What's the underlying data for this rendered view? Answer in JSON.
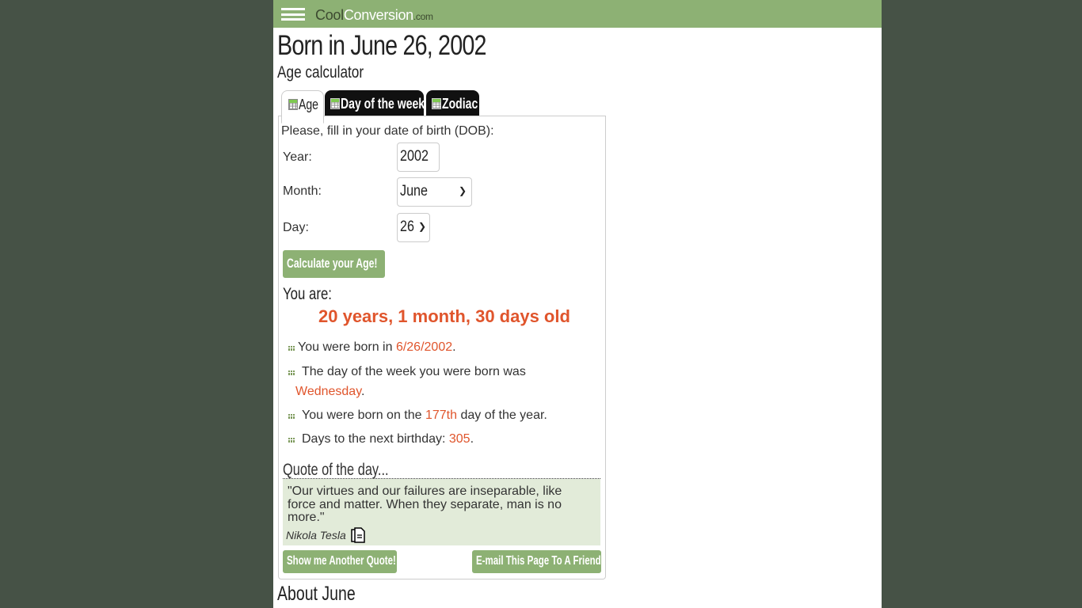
{
  "header": {
    "logo": {
      "part1": "Cool",
      "part2": "Conversion",
      "part3": ".com"
    },
    "menu_icon": "hamburger-menu-icon"
  },
  "page": {
    "title": "Born in June 26, 2002",
    "subtitle": "Age calculator"
  },
  "tabs": [
    {
      "label": "Age",
      "icon": "calculator-icon",
      "active": true
    },
    {
      "label": "Day of the week",
      "icon": "calculator-icon",
      "active": false
    },
    {
      "label": "Zodiac",
      "icon": "calculator-icon",
      "active": false
    }
  ],
  "form": {
    "instruction": "Please, fill in your date of birth (DOB):",
    "year_label": "Year:",
    "year_value": "2002",
    "month_label": "Month:",
    "month_value": "June",
    "day_label": "Day:",
    "day_value": "26",
    "submit_label": "Calculate your Age!"
  },
  "result": {
    "heading": "You are:",
    "age": "20 years, 1 month, 30 days old",
    "facts": [
      {
        "prefix": "You were born in ",
        "value": "6/26/2002",
        "suffix": "."
      },
      {
        "prefix": "The day of the week you were born was ",
        "value": "Wednesday",
        "suffix": "."
      },
      {
        "prefix": "You were born on the ",
        "value": "177th",
        "suffix": " day of the year."
      },
      {
        "prefix": "Days to the next birthday: ",
        "value": "305",
        "suffix": "."
      }
    ]
  },
  "quote": {
    "heading": "Quote of the day...",
    "text": "\"Our virtues and our failures are inseparable, like force and matter. When they separate, man is no more.\"",
    "author": "Nikola Tesla",
    "another_label": "Show me Another Quote!",
    "email_label": "E-mail This Page To A Friend"
  },
  "about": {
    "heading": "About June"
  },
  "colors": {
    "brand_green": "#8db174",
    "highlight": "#e0552c",
    "background": "#465246"
  }
}
